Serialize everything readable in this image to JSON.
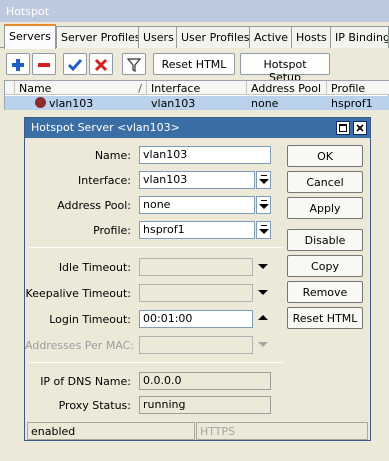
{
  "window": {
    "title": "Hotspot"
  },
  "tabs": [
    "Servers",
    "Server Profiles",
    "Users",
    "User Profiles",
    "Active",
    "Hosts",
    "IP Bindings"
  ],
  "toolbar": {
    "add_icon": "plus-icon",
    "remove_icon": "minus-icon",
    "enable_icon": "check-icon",
    "disable_icon": "x-icon",
    "filter_icon": "filter-icon",
    "reset_html": "Reset HTML",
    "hotspot_setup": "Hotspot Setup"
  },
  "table": {
    "columns": [
      "Name",
      "Interface",
      "Address Pool",
      "Profile"
    ],
    "sort_indicator": "/",
    "rows": [
      {
        "name": "vlan103",
        "interface": "vlan103",
        "address_pool": "none",
        "profile": "hsprof1"
      }
    ]
  },
  "dialog": {
    "title": "Hotspot Server <vlan103>",
    "fields": {
      "name": {
        "label": "Name:",
        "value": "vlan103"
      },
      "interface": {
        "label": "Interface:",
        "value": "vlan103"
      },
      "address_pool": {
        "label": "Address Pool:",
        "value": "none"
      },
      "profile": {
        "label": "Profile:",
        "value": "hsprof1"
      },
      "idle_timeout": {
        "label": "Idle Timeout:",
        "value": ""
      },
      "keepalive_timeout": {
        "label": "Keepalive Timeout:",
        "value": ""
      },
      "login_timeout": {
        "label": "Login Timeout:",
        "value": "00:01:00"
      },
      "addresses_per_mac": {
        "label": "Addresses Per MAC:",
        "value": ""
      },
      "ip_of_dns_name": {
        "label": "IP of DNS Name:",
        "value": "0.0.0.0"
      },
      "proxy_status": {
        "label": "Proxy Status:",
        "value": "running"
      }
    },
    "buttons": {
      "ok": "OK",
      "cancel": "Cancel",
      "apply": "Apply",
      "disable": "Disable",
      "copy": "Copy",
      "remove": "Remove",
      "reset_html": "Reset HTML"
    },
    "status": {
      "left": "enabled",
      "right": "HTTPS"
    }
  },
  "colors": {
    "selection": "#b9d1ea",
    "title_bar": "#3a6ea5",
    "add_icon": "#1f5fc5",
    "remove_icon": "#d42020",
    "enable_icon": "#1f5fc5",
    "disable_icon": "#d42020"
  }
}
